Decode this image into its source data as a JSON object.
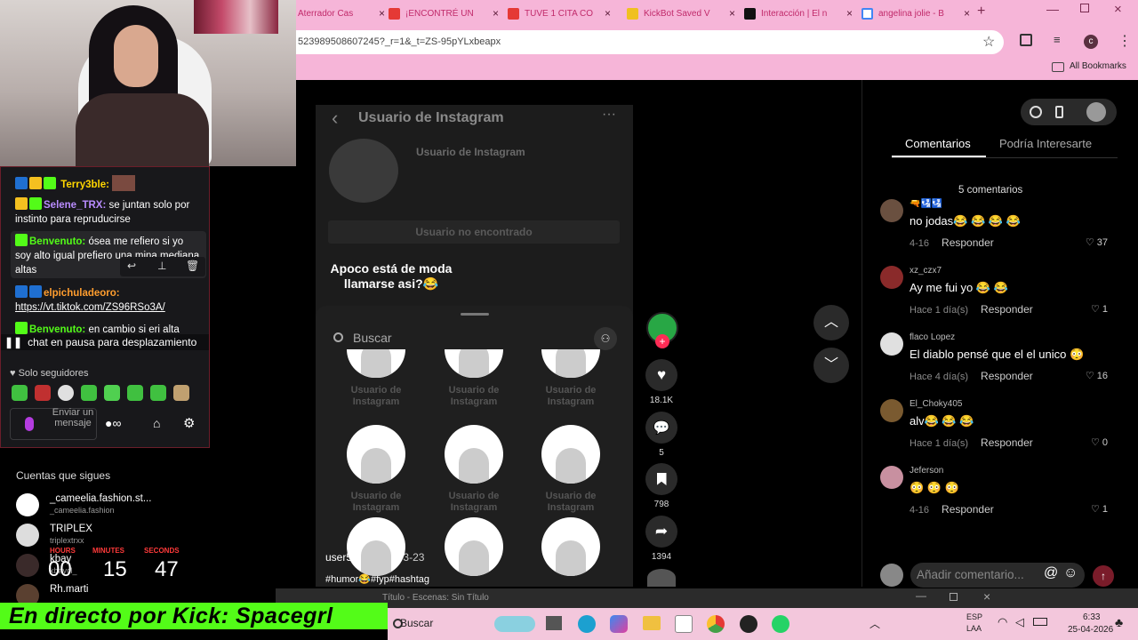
{
  "browser": {
    "tabs": [
      {
        "title": "Aterrador Cas",
        "fav": "#e53935"
      },
      {
        "title": "¡ENCONTRÉ UN",
        "fav": "#e53935"
      },
      {
        "title": "TUVE 1 CITA CO",
        "fav": "#e53935"
      },
      {
        "title": "KickBot Saved V",
        "fav": "#f0c020"
      },
      {
        "title": "Interacción | El n",
        "fav": "#111111"
      },
      {
        "title": "angelina jolie - B",
        "fav": "#4285f4"
      }
    ],
    "url": "523989508607245?_r=1&_t=ZS-95pYLxbeapx",
    "all_bookmarks": "All Bookmarks",
    "profile_initial": "c"
  },
  "video": {
    "profile_title": "Usuario de Instagram",
    "profile_name": "Usuario de Instagram",
    "not_found": "Usuario no encontrado",
    "caption_overlay": "Apoco está de moda\nllamarse asi?😂",
    "search_placeholder": "Buscar",
    "grid_label": "Usuario de\nInstagram",
    "author": "user56081357",
    "date": "· 3-23",
    "hashtags": "#humor😂#fyp#hashtag"
  },
  "rail": {
    "likes": "18.1K",
    "comments": "5",
    "saves": "798",
    "shares": "1394"
  },
  "panel": {
    "tab_comments": "Comentarios",
    "tab_interest": "Podría Interesarte",
    "count": "5 comentarios",
    "comments": [
      {
        "name": "🔫🛂🛂",
        "text": "no jodas😂 😂 😂 😂",
        "date": "4-16",
        "reply": "Responder",
        "likes": "37",
        "color": "#6a5040"
      },
      {
        "name": "xz_czx7",
        "text": "Ay me fui yo 😂 😂",
        "date": "Hace 1 día(s)",
        "reply": "Responder",
        "likes": "1",
        "color": "#8a2a2a"
      },
      {
        "name": "flaco Lopez",
        "text": "El diablo pensé que el el unico 😳",
        "date": "Hace 4 día(s)",
        "reply": "Responder",
        "likes": "16",
        "color": "#e0e0e0"
      },
      {
        "name": "El_Choky405",
        "text": "alv😂 😂 😂",
        "date": "Hace 1 día(s)",
        "reply": "Responder",
        "likes": "0",
        "color": "#7a5a30"
      },
      {
        "name": "Jeferson",
        "text": "😳 😳 😳",
        "date": "4-16",
        "reply": "Responder",
        "likes": "1",
        "color": "#c890a0"
      }
    ],
    "add_comment": "Añadir comentario..."
  },
  "stream": {
    "chat": [
      {
        "user": "Terry3ble:",
        "color": "#ffd600",
        "msg": ""
      },
      {
        "user": "Selene_TRX:",
        "color": "#b98cff",
        "msg": " se juntan solo por instinto para repruducirse"
      },
      {
        "user": "Benvenuto:",
        "color": "#53fc18",
        "msg": " ósea me refiero si yo soy alto igual prefiero una mina mediana altas"
      },
      {
        "user": "elpichuladeoro:",
        "color": "#ff9d2e",
        "msg": ""
      },
      {
        "user": "Benvenuto:",
        "color": "#53fc18",
        "msg": " en cambio si eri alta"
      }
    ],
    "chat_link": "https://vt.tiktok.com/ZS96RSo3A/",
    "paused": "chat en pausa para desplazamiento",
    "followers_only": "Solo seguidores",
    "send_placeholder": "Enviar un mensaje",
    "following_title": "Cuentas que sigues",
    "following": [
      {
        "name": "_cameelia.fashion.st...",
        "sub": "_cameelia.fashion"
      },
      {
        "name": "TRIPLEX",
        "sub": "triplextrxx"
      },
      {
        "name": "kbay",
        "sub": "kbaycl_"
      },
      {
        "name": "Rh.marti",
        "sub": ""
      }
    ],
    "timer": {
      "hours_label": "HOURS",
      "minutes_label": "MINUTES",
      "seconds_label": "SECONDS",
      "hours": "00",
      "minutes": "15",
      "seconds": "47"
    },
    "banner": "En directo por Kick: Spacegrl"
  },
  "obs": {
    "title": "Título - Escenas: Sin Título"
  },
  "taskbar": {
    "search": "Buscar",
    "lang1": "ESP",
    "lang2": "LAA",
    "time": "6:33",
    "date": "25-04-2026"
  }
}
